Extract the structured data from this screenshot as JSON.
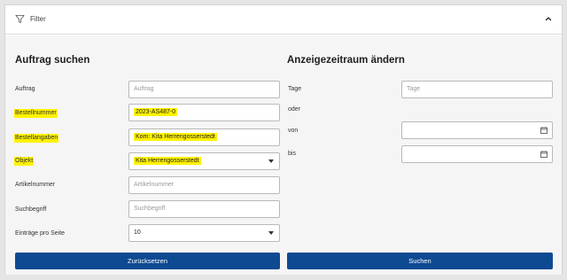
{
  "filter": {
    "label": "Filter"
  },
  "search": {
    "title": "Auftrag suchen",
    "fields": {
      "auftrag": {
        "label": "Auftrag",
        "placeholder": "Auftrag"
      },
      "bestellnummer": {
        "label": "Bestellnummer",
        "value": "2023-AS487-0"
      },
      "bestellangaben": {
        "label": "Bestellangaben",
        "value": "Kom: Kita Herrengosserstedt"
      },
      "objekt": {
        "label": "Objekt",
        "value": "Kita Herrengosserstedt"
      },
      "artikelnummer": {
        "label": "Artikelnummer",
        "placeholder": "Artikelnummer"
      },
      "suchbegriff": {
        "label": "Suchbegriff",
        "placeholder": "Suchbegriff"
      },
      "eintraege": {
        "label": "Einträge pro Seite",
        "value": "10"
      }
    },
    "reset_label": "Zurücksetzen"
  },
  "period": {
    "title": "Anzeigezeitraum ändern",
    "tage": {
      "label": "Tage",
      "placeholder": "Tage"
    },
    "oder": "oder",
    "von": {
      "label": "von"
    },
    "bis": {
      "label": "bis"
    },
    "search_label": "Suchen"
  },
  "colors": {
    "highlight": "#fff200",
    "button": "#0e4a92"
  },
  "icons": {
    "filter": "filter-icon",
    "collapse": "chevron-up-icon",
    "calendar": "calendar-icon",
    "dropdown": "caret-down-icon"
  }
}
